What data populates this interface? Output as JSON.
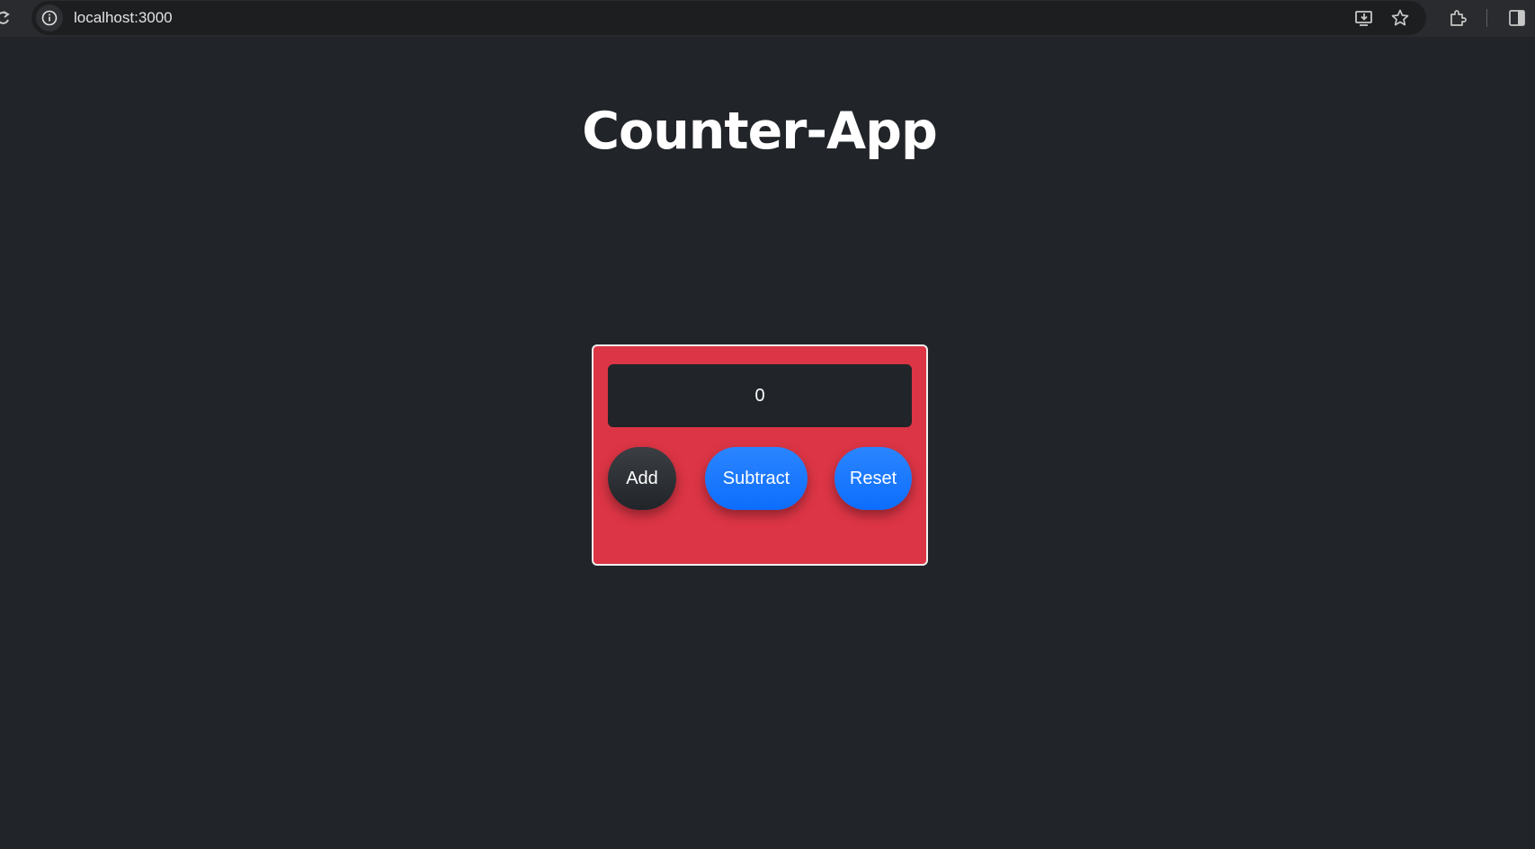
{
  "browser": {
    "url": "localhost:3000"
  },
  "page": {
    "title": "Counter-App"
  },
  "counter": {
    "value": "0",
    "buttons": {
      "add": "Add",
      "subtract": "Subtract",
      "reset": "Reset"
    }
  },
  "colors": {
    "page_background": "#212428",
    "card_background": "#dc3545",
    "display_background": "#212529",
    "add_button": "#212529",
    "primary_button": "#0d6efd"
  },
  "icons": [
    "reload-icon",
    "site-info-icon",
    "install-app-icon",
    "bookmark-star-icon",
    "extensions-icon",
    "side-panel-icon"
  ]
}
